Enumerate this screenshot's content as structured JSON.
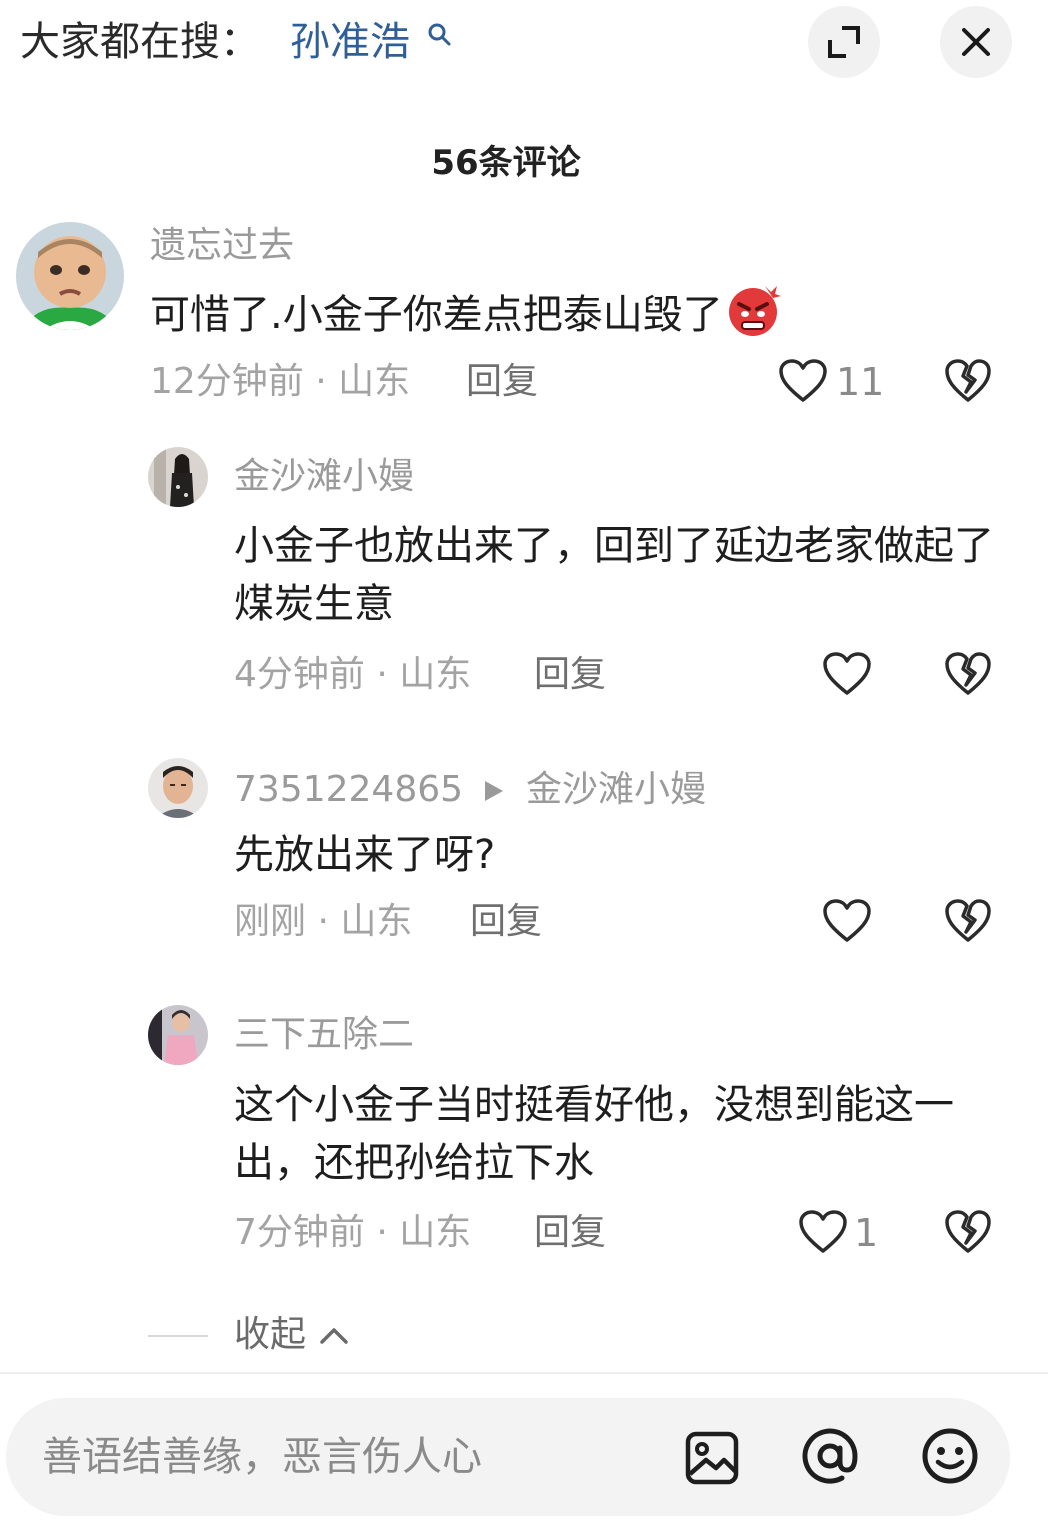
{
  "header": {
    "search_prefix": "大家都在搜：",
    "search_term": "孙准浩"
  },
  "comments_title": "56条评论",
  "comments": [
    {
      "username": "遗忘过去",
      "text": "可惜了.小金子你差点把泰山毁了",
      "emoji": "angry-face-emoji",
      "time": "12分钟前",
      "location": "山东",
      "reply_label": "回复",
      "likes": "11"
    }
  ],
  "replies": [
    {
      "username": "金沙滩小嫚",
      "text": "小金子也放出来了，回到了延边老家做起了煤炭生意",
      "time": "4分钟前",
      "location": "山东",
      "reply_label": "回复",
      "likes": ""
    },
    {
      "username": "7351224865",
      "reply_to": "金沙滩小嫚",
      "text": "先放出来了呀?",
      "time": "刚刚",
      "location": "山东",
      "reply_label": "回复",
      "likes": ""
    },
    {
      "username": "三下五除二",
      "text": "这个小金子当时挺看好他，没想到能这一出，还把孙给拉下水",
      "time": "7分钟前",
      "location": "山东",
      "reply_label": "回复",
      "likes": "1"
    }
  ],
  "collapse_label": "收起",
  "input": {
    "placeholder": "善语结善缘，恶言伤人心"
  },
  "meta_separator": " · ",
  "colors": {
    "search_term": "#2f5f97",
    "meta_gray": "#a3a3a3",
    "text": "#1e1e1e",
    "input_bg": "#f3f3f3"
  },
  "icons": [
    "search-icon",
    "expand-icon",
    "close-icon",
    "heart-icon",
    "broken-heart-icon",
    "image-icon",
    "at-icon",
    "emoji-icon"
  ]
}
